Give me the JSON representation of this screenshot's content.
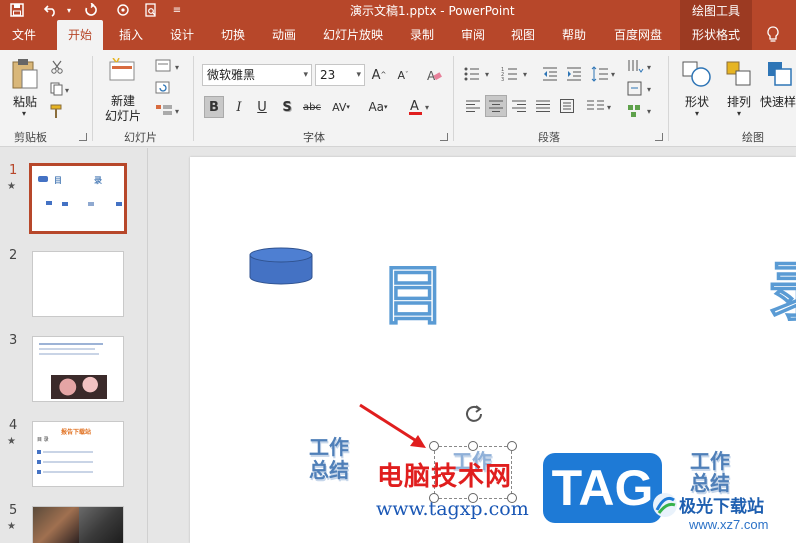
{
  "titlebar": {
    "doc_title": "演示文稿1.pptx  -  PowerPoint",
    "context_group": "绘图工具",
    "quick_access": [
      "save-icon",
      "undo-icon",
      "redo-icon",
      "touch-mode-icon",
      "print-preview-icon",
      "customize-icon"
    ]
  },
  "tabs": [
    "文件",
    "开始",
    "插入",
    "设计",
    "切换",
    "动画",
    "幻灯片放映",
    "录制",
    "审阅",
    "视图",
    "帮助",
    "百度网盘",
    "形状格式"
  ],
  "active_tab": "开始",
  "ribbon": {
    "clipboard": {
      "paste_label": "粘贴",
      "group_label": "剪贴板"
    },
    "slides": {
      "new_slide_label_1": "新建",
      "new_slide_label_2": "幻灯片",
      "group_label": "幻灯片"
    },
    "font": {
      "font_name": "微软雅黑",
      "font_size": "23",
      "group_label": "字体"
    },
    "paragraph": {
      "group_label": "段落"
    },
    "drawing": {
      "shape_label": "形状",
      "arrange_label": "排列",
      "quick_style_label": "快速样",
      "group_label": "绘图"
    }
  },
  "thumbnails": [
    {
      "num": "1",
      "star": "★",
      "selected": true
    },
    {
      "num": "2",
      "star": "",
      "selected": false
    },
    {
      "num": "3",
      "star": "",
      "selected": false
    },
    {
      "num": "4",
      "star": "★",
      "selected": false
    },
    {
      "num": "5",
      "star": "★",
      "selected": false
    }
  ],
  "thumb1": {
    "text1": "目",
    "text2": "录"
  },
  "thumb4": {
    "title": "报告下载站",
    "head": "目 录"
  },
  "slide": {
    "big_char_1": "目",
    "big_char_2": "录",
    "work_summary_left_1": "工作",
    "work_summary_left_2": "总结",
    "selected_text": "工作",
    "work_summary_right_1": "工作",
    "work_summary_right_2": "总结"
  },
  "watermark": {
    "site_name": "电脑技术网",
    "site_url": "www.tagxp.com",
    "badge": "TAG",
    "jg_name": "极光下载站",
    "jg_url": "www.xz7.com"
  },
  "colors": {
    "accent": "#b7472a",
    "shape_blue": "#4472c4"
  }
}
